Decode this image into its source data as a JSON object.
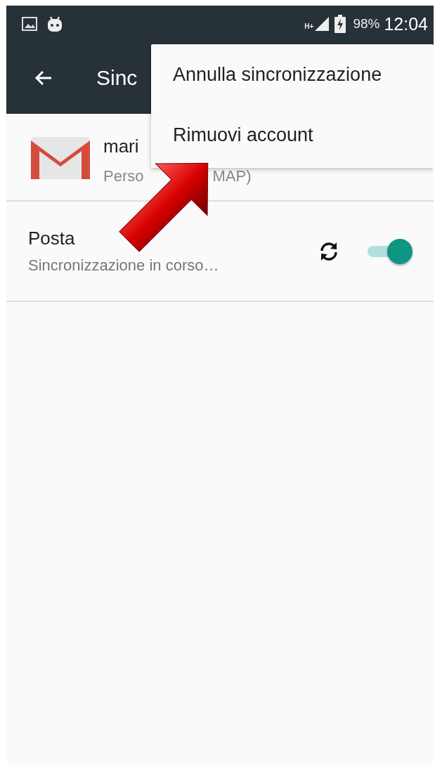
{
  "status_bar": {
    "battery": "98%",
    "time": "12:04",
    "network": "H+"
  },
  "toolbar": {
    "title": "Sinc"
  },
  "account": {
    "name": "mari",
    "subtitle_parts": [
      "Perso",
      "MAP)"
    ]
  },
  "sync_items": [
    {
      "kind": "toggle",
      "title": "Posta",
      "subtitle": "Sincronizzazione in corso…",
      "on": true
    }
  ],
  "menu": {
    "items": [
      {
        "label": "Annulla sincronizzazione"
      },
      {
        "label": "Rimuovi account"
      }
    ]
  }
}
